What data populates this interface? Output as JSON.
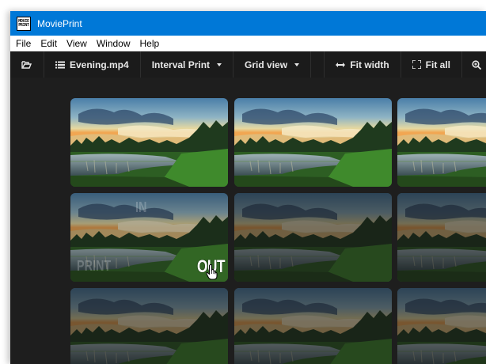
{
  "window": {
    "title": "MoviePrint",
    "icon_line1": "MOVIE",
    "icon_line2": "PRINT"
  },
  "menu": {
    "items": [
      "File",
      "Edit",
      "View",
      "Window",
      "Help"
    ]
  },
  "toolbar": {
    "open_icon": "folder-open-icon",
    "file_label": "Evening.mp4",
    "mode_label": "Interval Print",
    "view_label": "Grid view",
    "fit_width_label": "Fit width",
    "fit_all_label": "Fit all",
    "zoom_icon": "zoom-icon"
  },
  "thumbnail": {
    "hover_label": "OUT",
    "ghost_top": "IN",
    "ghost_left": "PRINT"
  },
  "colors": {
    "titlebar": "#0078d7",
    "toolbar_bg": "#1b1b1b",
    "canvas_bg": "#1e1e1e"
  }
}
